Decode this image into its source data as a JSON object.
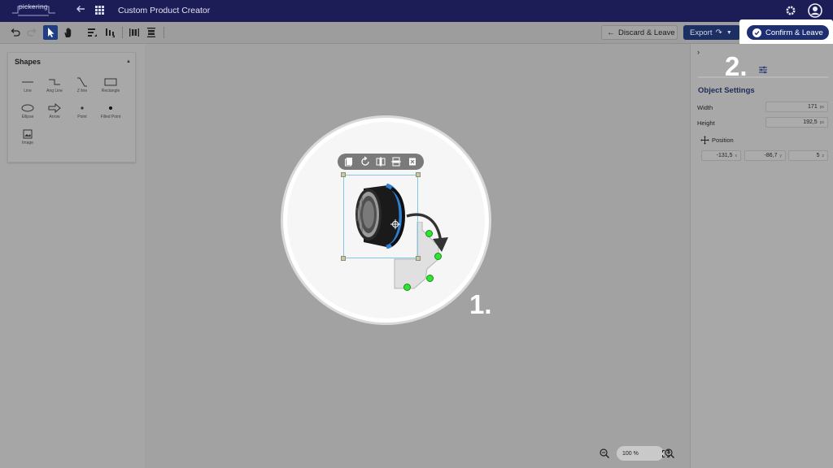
{
  "header": {
    "logo_text": "pickering",
    "title": "Custom Product Creator",
    "icons": [
      "back-arrow-icon",
      "apps-grid-icon",
      "gear-icon",
      "account-icon"
    ]
  },
  "toolbar": {
    "discard_label": "Discard & Leave",
    "export_label": "Export",
    "confirm_label": "Confirm & Leave",
    "icons": [
      "undo-icon",
      "redo-icon",
      "pointer-icon",
      "hand-icon",
      "bring-forward-icon",
      "send-backward-icon",
      "align-vertical-icon",
      "align-horizontal-icon"
    ]
  },
  "shapes": {
    "title": "Shapes",
    "items": [
      {
        "label": "Line",
        "icon": "line-icon"
      },
      {
        "label": "Ang Line",
        "icon": "angled-line-icon"
      },
      {
        "label": "Z line",
        "icon": "z-line-icon"
      },
      {
        "label": "Rectangle",
        "icon": "rectangle-icon"
      },
      {
        "label": "Ellipse",
        "icon": "ellipse-icon"
      },
      {
        "label": "Arrow",
        "icon": "arrow-icon"
      },
      {
        "label": "Point",
        "icon": "point-icon"
      },
      {
        "label": "Filled Point",
        "icon": "filled-point-icon"
      },
      {
        "label": "Image",
        "icon": "image-icon"
      }
    ]
  },
  "object_settings": {
    "title": "Object Settings",
    "width_label": "Width",
    "width_value": "171",
    "height_label": "Height",
    "height_value": "192,5",
    "unit": "px",
    "position_label": "Position",
    "position_x": "-131,5",
    "position_y": "-86,7",
    "position_z": "5",
    "pos_unit_x": "x",
    "pos_unit_y": "y",
    "pos_unit_z": "z"
  },
  "zoom": {
    "level": "100 %"
  },
  "annotations": {
    "step1": "1.",
    "step2": "2."
  },
  "colors": {
    "header_bg": "#1c1c56",
    "confirm_bg": "#1d2f71",
    "export_bg": "#1c2f63",
    "point_green": "#2ee62e"
  }
}
